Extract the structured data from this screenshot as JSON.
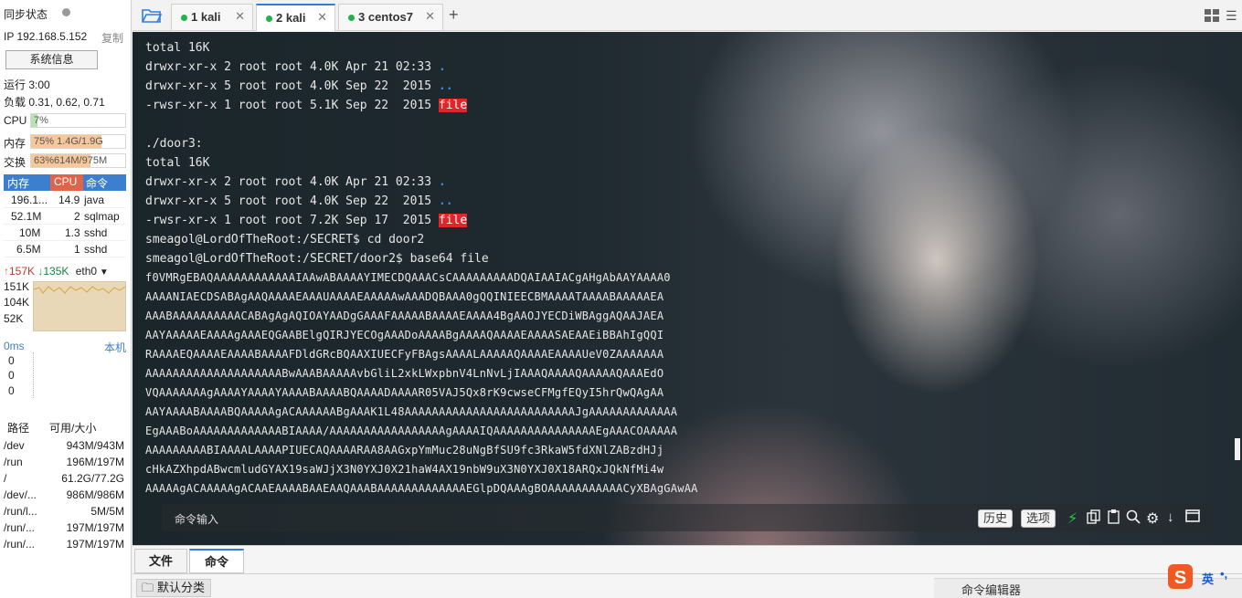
{
  "sidebar": {
    "sync_status": "同步状态",
    "ip_label": "IP 192.168.5.152",
    "copy_label": "复制",
    "sysinfo_button": "系统信息",
    "uptime": "运行 3:00",
    "load": "负载 0.31, 0.62, 0.71",
    "cpu_label": "CPU",
    "cpu_value": "7%",
    "cpu_percent": 7,
    "mem_label": "内存",
    "mem_value": "75%    1.4G/1.9G",
    "mem_percent": 75,
    "swap_label": "交换",
    "swap_value": "63%614M/975M",
    "swap_percent": 63,
    "proc_headers": [
      "内存",
      "CPU",
      "命令"
    ],
    "processes": [
      {
        "mem": "196.1...",
        "cpu": "14.9",
        "cmd": "java"
      },
      {
        "mem": "52.1M",
        "cpu": "2",
        "cmd": "sqlmap"
      },
      {
        "mem": "10M",
        "cpu": "1.3",
        "cmd": "sshd"
      },
      {
        "mem": "6.5M",
        "cpu": "1",
        "cmd": "sshd"
      }
    ],
    "net_up": "157K",
    "net_down": "135K",
    "net_iface": "eth0",
    "net_scale": [
      "151K",
      "104K",
      "52K"
    ],
    "ping_label": "0ms",
    "ping_host": "本机",
    "ping_values": [
      "0",
      "0",
      "0"
    ],
    "disk_headers": [
      "路径",
      "可用/大小"
    ],
    "disks": [
      {
        "path": "/dev",
        "size": "943M/943M"
      },
      {
        "path": "/run",
        "size": "196M/197M"
      },
      {
        "path": "/",
        "size": "61.2G/77.2G"
      },
      {
        "path": "/dev/...",
        "size": "986M/986M"
      },
      {
        "path": "/run/l...",
        "size": "5M/5M"
      },
      {
        "path": "/run/...",
        "size": "197M/197M"
      },
      {
        "path": "/run/...",
        "size": "197M/197M"
      }
    ]
  },
  "tabs": [
    {
      "label": "1 kali"
    },
    {
      "label": "2 kali"
    },
    {
      "label": "3 centos7"
    }
  ],
  "terminal": {
    "lines": [
      "total 16K",
      "drwxr-xr-x 2 root root 4.0K Apr 21 02:33 ",
      "drwxr-xr-x 5 root root 4.0K Sep 22  2015 ",
      "-rwsr-xr-x 1 root root 5.1K Sep 22  2015 ",
      "",
      "./door3:",
      "total 16K",
      "drwxr-xr-x 2 root root 4.0K Apr 21 02:33 ",
      "drwxr-xr-x 5 root root 4.0K Sep 22  2015 ",
      "-rwsr-xr-x 1 root root 7.2K Sep 17  2015 ",
      "smeagol@LordOfTheRoot:/SECRET$ cd door2",
      "smeagol@LordOfTheRoot:/SECRET/door2$ base64 file",
      "f0VMRgEBAQAAAAAAAAAAAAIAAwABAAAAYIMECDQAAACsCAAAAAAAAADQAIAAIACgAHgAbAAYAAAA0",
      "AAAANIAECDSABAgAAQAAAAEAAAUAAAAEAAAAAwAAADQBAAA0gQQINIEECBMAAAATAAAABAAAAAEA",
      "AAABAAAAAAAAAACABAgAgAQIOAYAADgGAAAFAAAAABAAAAEAAAA4BgAAOJYECDiWBAggAQAAJAEA",
      "AAYAAAAAEAAAAgAAAEQGAABElgQIRJYECOgAAADoAAAABgAAAAQAAAAEAAAASAEAAEiBBAhIgQQI",
      "RAAAAEQAAAAEAAAABAAAAFDldGRcBQAAXIUECFyFBAgsAAAALAAAAAQAAAAEAAAAUeV0ZAAAAAAA",
      "AAAAAAAAAAAAAAAAAAAABwAAABAAAAAvbGliL2xkLWxpbnV4LnNvLjIAAAQAAAAQAAAAAQAAAEdO",
      "VQAAAAAAAgAAAAYAAAAYAAAABAAAABQAAAADAAAAR05VAJ5Qx8rK9cwseCFMgfEQyI5hrQwQAgAA",
      "AAYAAAABAAAABQAAAAAgACAAAAAABgAAAK1L48AAAAAAAAAAAAAAAAAAAAAAAAAJgAAAAAAAAAAAAA",
      "EgAAABoAAAAAAAAAAAAABIAAAA/AAAAAAAAAAAAAAAAAgAAAAIQAAAAAAAAAAAAAAAEgAAACOAAAAA",
      "AAAAAAAAABIAAAALAAAAPIUECAQAAAARAA8AAGxpYmMuc28uNgBfSU9fc3RkaW5fdXNlZABzdHJj",
      "cHkAZXhpdABwcmludGYAX19saWJjX3N0YXJ0X21haW4AX19nbW9uX3N0YXJ0X18ARQxJQkNfMi4w",
      "AAAAAgACAAAAAgACAAEAAAABAAEAAQAAABAAAAAAAAAAAAAEGlpDQAAAgBOAAAAAAAAAAACyXBAgGAwAA"
    ],
    "blue_dot": ".",
    "blue_dotdot": "..",
    "red_file": "file",
    "command_placeholder": "命令输入",
    "history_button": "历史",
    "options_button": "选项"
  },
  "bottom": {
    "tab_files": "文件",
    "tab_commands": "命令",
    "category_button": "默认分类",
    "command_editor": "命令编辑器",
    "ime_label": "英"
  },
  "colors": {
    "accent": "#2f7de1",
    "online_dot": "#22b14c",
    "file_highlight": "#e0262a",
    "dir_blue": "#3b8ee8",
    "cpu_gauge": "#b6e3b0",
    "mem_gauge": "#f5c79a",
    "swap_gauge": "#f5c79a"
  }
}
